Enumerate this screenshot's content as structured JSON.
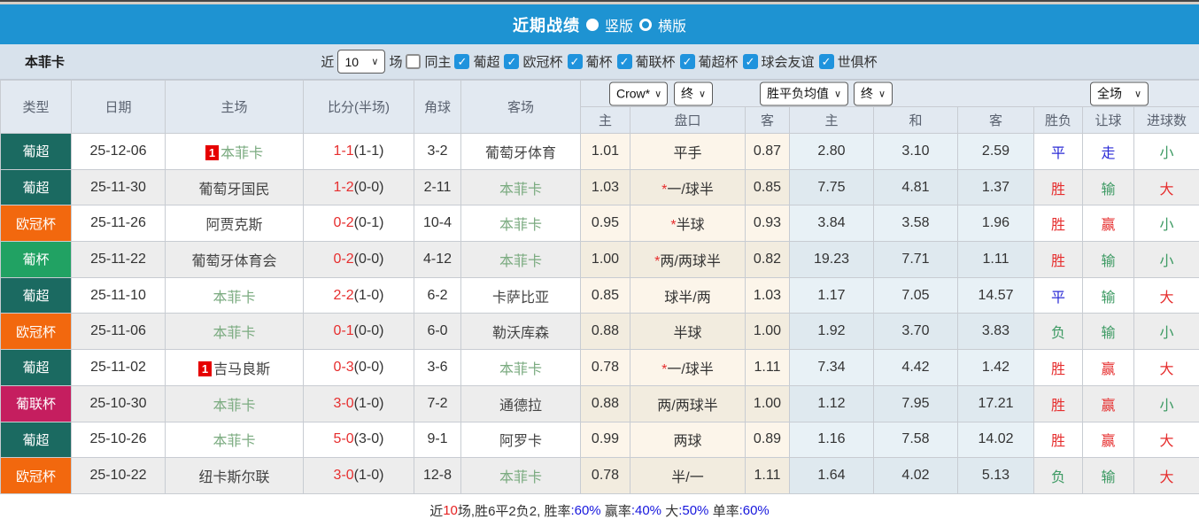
{
  "title_bar": {
    "title": "近期战绩",
    "vertical_label": "竖版",
    "horizontal_label": "横版",
    "vertical_selected": true
  },
  "filter_bar": {
    "team_name": "本菲卡",
    "recent_label": "近",
    "recent_value": "10",
    "games_label": "场",
    "same_home_label": "同主",
    "same_home_checked": false,
    "leagues": [
      {
        "label": "葡超",
        "checked": true
      },
      {
        "label": "欧冠杯",
        "checked": true
      },
      {
        "label": "葡杯",
        "checked": true
      },
      {
        "label": "葡联杯",
        "checked": true
      },
      {
        "label": "葡超杯",
        "checked": true
      },
      {
        "label": "球会友谊",
        "checked": true
      },
      {
        "label": "世俱杯",
        "checked": true
      }
    ]
  },
  "table": {
    "main_headers": [
      "类型",
      "日期",
      "主场",
      "比分(半场)",
      "角球",
      "客场"
    ],
    "sub_headers": [
      "主",
      "盘口",
      "客",
      "主",
      "和",
      "客",
      "胜负",
      "让球",
      "进球数"
    ],
    "dropdowns": [
      {
        "label": "Crow*"
      },
      {
        "label": "终"
      },
      {
        "label": "胜平负均值"
      },
      {
        "label": "终"
      },
      {
        "label": "全场"
      }
    ],
    "rows": [
      {
        "type": "葡超",
        "date": "25-12-06",
        "home": {
          "name": "本菲卡",
          "self": true,
          "rank": "1"
        },
        "score": "1-1",
        "half": "(1-1)",
        "corners": "3-2",
        "away": {
          "name": "葡萄牙体育",
          "self": false
        },
        "crow": {
          "home": "1.01",
          "star": false,
          "pan": "平手",
          "away": "0.87"
        },
        "avg": [
          "2.80",
          "3.10",
          "2.59"
        ],
        "res": [
          [
            "平",
            "blue"
          ],
          [
            "走",
            "blue"
          ],
          [
            "小",
            "green"
          ]
        ]
      },
      {
        "type": "葡超",
        "date": "25-11-30",
        "home": {
          "name": "葡萄牙国民",
          "self": false
        },
        "score": "1-2",
        "half": "(0-0)",
        "corners": "2-11",
        "away": {
          "name": "本菲卡",
          "self": true
        },
        "crow": {
          "home": "1.03",
          "star": true,
          "pan": "一/球半",
          "away": "0.85"
        },
        "avg": [
          "7.75",
          "4.81",
          "1.37"
        ],
        "res": [
          [
            "胜",
            "red"
          ],
          [
            "输",
            "green"
          ],
          [
            "大",
            "red"
          ]
        ]
      },
      {
        "type": "欧冠杯",
        "date": "25-11-26",
        "home": {
          "name": "阿贾克斯",
          "self": false
        },
        "score": "0-2",
        "half": "(0-1)",
        "corners": "10-4",
        "away": {
          "name": "本菲卡",
          "self": true
        },
        "crow": {
          "home": "0.95",
          "star": true,
          "pan": "半球",
          "away": "0.93"
        },
        "avg": [
          "3.84",
          "3.58",
          "1.96"
        ],
        "res": [
          [
            "胜",
            "red"
          ],
          [
            "赢",
            "red"
          ],
          [
            "小",
            "green"
          ]
        ]
      },
      {
        "type": "葡杯",
        "date": "25-11-22",
        "home": {
          "name": "葡萄牙体育会",
          "self": false
        },
        "score": "0-2",
        "half": "(0-0)",
        "corners": "4-12",
        "away": {
          "name": "本菲卡",
          "self": true
        },
        "crow": {
          "home": "1.00",
          "star": true,
          "pan": "两/两球半",
          "away": "0.82"
        },
        "avg": [
          "19.23",
          "7.71",
          "1.11"
        ],
        "res": [
          [
            "胜",
            "red"
          ],
          [
            "输",
            "green"
          ],
          [
            "小",
            "green"
          ]
        ]
      },
      {
        "type": "葡超",
        "date": "25-11-10",
        "home": {
          "name": "本菲卡",
          "self": true
        },
        "score": "2-2",
        "half": "(1-0)",
        "corners": "6-2",
        "away": {
          "name": "卡萨比亚",
          "self": false
        },
        "crow": {
          "home": "0.85",
          "star": false,
          "pan": "球半/两",
          "away": "1.03"
        },
        "avg": [
          "1.17",
          "7.05",
          "14.57"
        ],
        "res": [
          [
            "平",
            "blue"
          ],
          [
            "输",
            "green"
          ],
          [
            "大",
            "red"
          ]
        ]
      },
      {
        "type": "欧冠杯",
        "date": "25-11-06",
        "home": {
          "name": "本菲卡",
          "self": true
        },
        "score": "0-1",
        "half": "(0-0)",
        "corners": "6-0",
        "away": {
          "name": "勒沃库森",
          "self": false
        },
        "crow": {
          "home": "0.88",
          "star": false,
          "pan": "半球",
          "away": "1.00"
        },
        "avg": [
          "1.92",
          "3.70",
          "3.83"
        ],
        "res": [
          [
            "负",
            "green"
          ],
          [
            "输",
            "green"
          ],
          [
            "小",
            "green"
          ]
        ]
      },
      {
        "type": "葡超",
        "date": "25-11-02",
        "home": {
          "name": "吉马良斯",
          "self": false,
          "rank": "1"
        },
        "score": "0-3",
        "half": "(0-0)",
        "corners": "3-6",
        "away": {
          "name": "本菲卡",
          "self": true
        },
        "crow": {
          "home": "0.78",
          "star": true,
          "pan": "一/球半",
          "away": "1.11"
        },
        "avg": [
          "7.34",
          "4.42",
          "1.42"
        ],
        "res": [
          [
            "胜",
            "red"
          ],
          [
            "赢",
            "red"
          ],
          [
            "大",
            "red"
          ]
        ]
      },
      {
        "type": "葡联杯",
        "date": "25-10-30",
        "home": {
          "name": "本菲卡",
          "self": true
        },
        "score": "3-0",
        "half": "(1-0)",
        "corners": "7-2",
        "away": {
          "name": "通德拉",
          "self": false
        },
        "crow": {
          "home": "0.88",
          "star": false,
          "pan": "两/两球半",
          "away": "1.00"
        },
        "avg": [
          "1.12",
          "7.95",
          "17.21"
        ],
        "res": [
          [
            "胜",
            "red"
          ],
          [
            "赢",
            "red"
          ],
          [
            "小",
            "green"
          ]
        ]
      },
      {
        "type": "葡超",
        "date": "25-10-26",
        "home": {
          "name": "本菲卡",
          "self": true
        },
        "score": "5-0",
        "half": "(3-0)",
        "corners": "9-1",
        "away": {
          "name": "阿罗卡",
          "self": false
        },
        "crow": {
          "home": "0.99",
          "star": false,
          "pan": "两球",
          "away": "0.89"
        },
        "avg": [
          "1.16",
          "7.58",
          "14.02"
        ],
        "res": [
          [
            "胜",
            "red"
          ],
          [
            "赢",
            "red"
          ],
          [
            "大",
            "red"
          ]
        ]
      },
      {
        "type": "欧冠杯",
        "date": "25-10-22",
        "home": {
          "name": "纽卡斯尔联",
          "self": false
        },
        "score": "3-0",
        "half": "(1-0)",
        "corners": "12-8",
        "away": {
          "name": "本菲卡",
          "self": true
        },
        "crow": {
          "home": "0.78",
          "star": false,
          "pan": "半/一",
          "away": "1.11"
        },
        "avg": [
          "1.64",
          "4.02",
          "5.13"
        ],
        "res": [
          [
            "负",
            "green"
          ],
          [
            "输",
            "green"
          ],
          [
            "大",
            "red"
          ]
        ]
      }
    ]
  },
  "summary": {
    "segments": [
      {
        "t": "近",
        "c": "dark"
      },
      {
        "t": "10",
        "c": "red"
      },
      {
        "t": "场,胜6平2负2, ",
        "c": "dark"
      },
      {
        "t": "胜率",
        "c": "dark"
      },
      {
        "t": ":60%",
        "c": "blue"
      },
      {
        "t": " 赢率",
        "c": "dark"
      },
      {
        "t": ":40%",
        "c": "blue"
      },
      {
        "t": " 大",
        "c": "dark"
      },
      {
        "t": ":50%",
        "c": "blue"
      },
      {
        "t": " 单率",
        "c": "dark"
      },
      {
        "t": ":60%",
        "c": "blue"
      }
    ]
  },
  "colors": {
    "accent_blue_bar": "#1e93d2",
    "type_colors": {
      "葡超": "#1b6a61",
      "欧冠杯": "#f2680e",
      "葡杯": "#21a263",
      "葡联杯": "#c51e5f"
    },
    "self_team_green": "#7bab80",
    "other_team": "#444444",
    "score_red": "#e62e2e",
    "result_red": "#e62e2e",
    "result_blue": "#2b2bd6",
    "result_green": "#3d9a63",
    "summary_blue": "#1717dd",
    "summary_red": "#e62222",
    "rank_badge_red": "#e60000",
    "checkbox_blue": "#1f93dd"
  },
  "icons": {
    "check": "✓",
    "caret": "∨"
  }
}
